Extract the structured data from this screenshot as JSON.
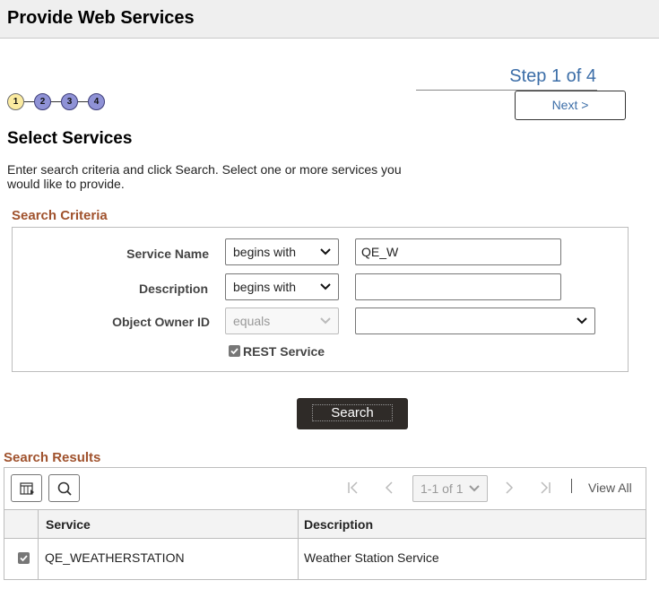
{
  "page": {
    "title": "Provide Web Services"
  },
  "step": {
    "label": "Step 1 of 4",
    "items": [
      "1",
      "2",
      "3",
      "4"
    ]
  },
  "next_label": "Next >",
  "section": {
    "title": "Select Services",
    "instructions": "Enter search criteria and click Search. Select one or more services you would like to provide."
  },
  "criteria": {
    "title": "Search Criteria",
    "service_name": {
      "label": "Service Name",
      "operator": "begins with",
      "value": "QE_W"
    },
    "description": {
      "label": "Description",
      "operator": "begins with",
      "value": ""
    },
    "object_owner": {
      "label": "Object Owner ID",
      "operator": "equals",
      "value": ""
    },
    "rest_service": {
      "label": "REST Service",
      "checked": true
    }
  },
  "search_label": "Search",
  "results": {
    "title": "Search Results",
    "pager": "1-1 of 1",
    "view_all": "View All",
    "columns": [
      "Service",
      "Description"
    ],
    "rows": [
      {
        "checked": true,
        "service": "QE_WEATHERSTATION",
        "description": "Weather Station Service"
      }
    ]
  }
}
